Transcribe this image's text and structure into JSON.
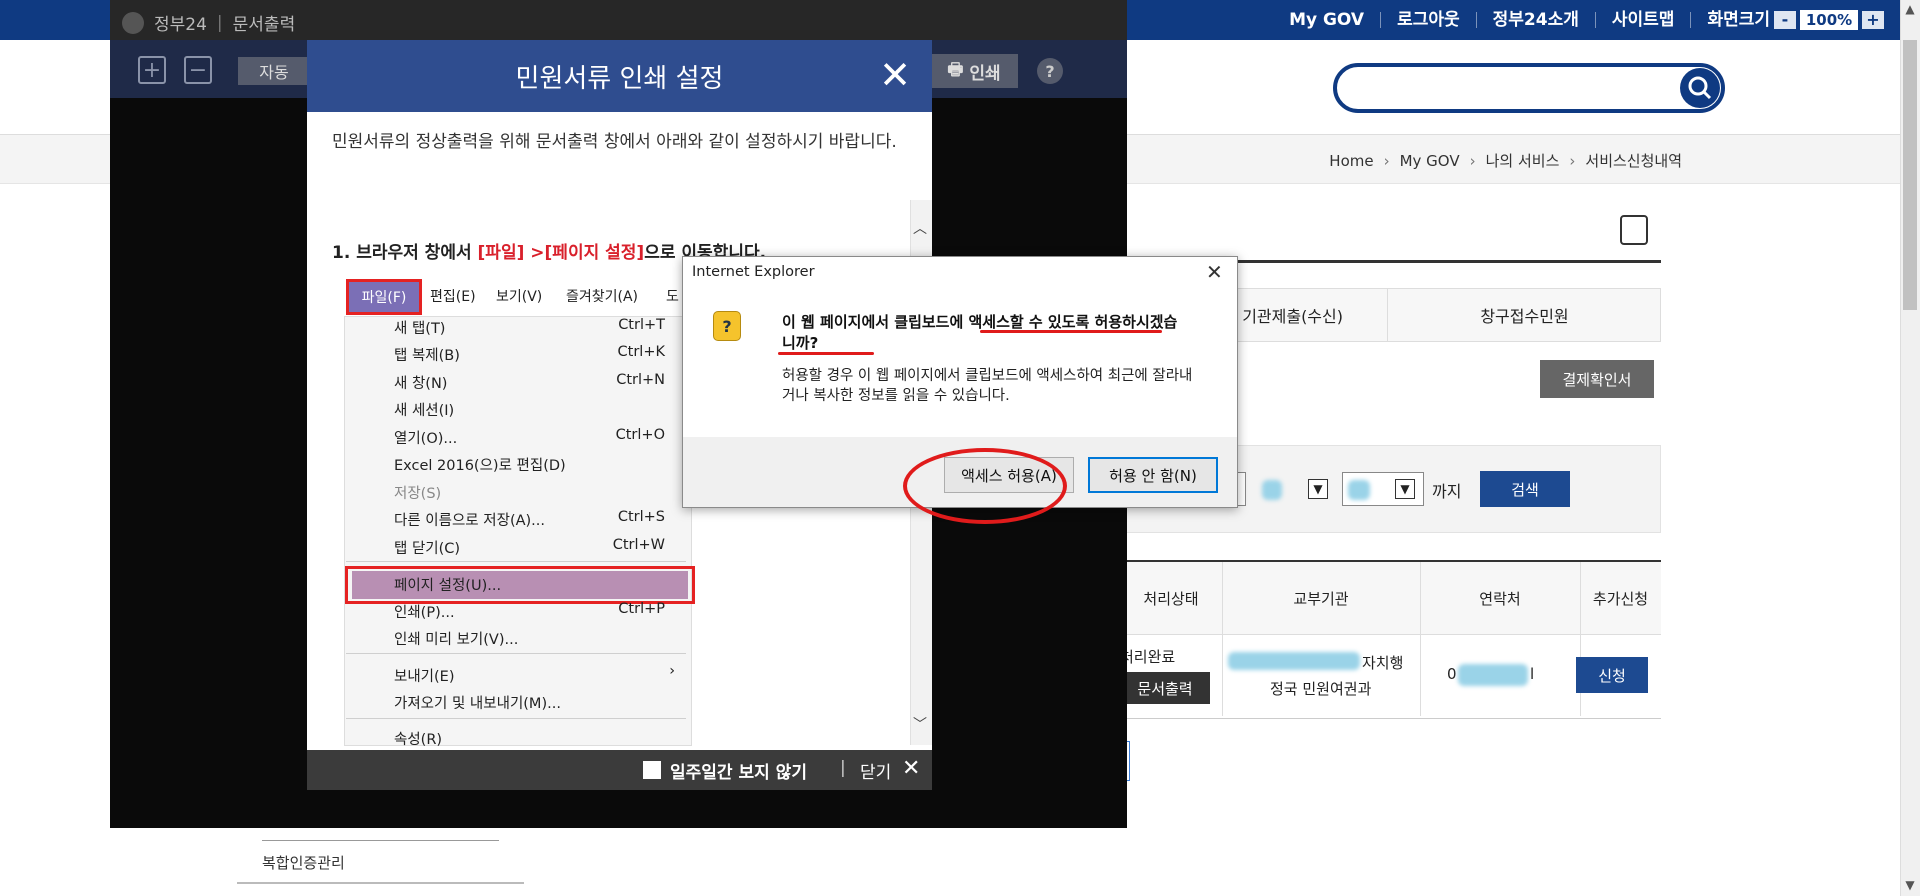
{
  "site": {
    "toplinks": [
      "My GOV",
      "로그아웃",
      "정부24소개",
      "사이트맵",
      "화면크기"
    ],
    "zoom": {
      "minus": "-",
      "value": "100%",
      "plus": "+"
    }
  },
  "breadcrumb": [
    "Home",
    "My GOV",
    "나의 서비스",
    "서비스신청내역"
  ],
  "tabs": [
    "기관제출(수신)",
    "창구접수민원"
  ],
  "pay_button": "결제확인서",
  "filter": {
    "until_label": "까지",
    "search_button": "검색"
  },
  "table": {
    "headers": [
      "처리상태",
      "교부기관",
      "연락처",
      "추가신청"
    ],
    "row": {
      "status": "처리완료",
      "doc_button": "문서출력",
      "agency_line1": "자치행",
      "agency_line2": "정국 민원여권과",
      "phone_prefix": "0",
      "phone_suffix": "l",
      "apply_button": "신청"
    }
  },
  "left_menu": {
    "item": "복합인증관리"
  },
  "doc_window": {
    "app_name": "정부24",
    "title": "문서출력",
    "auto_button": "자동",
    "print_button": "인쇄",
    "help_button": "?",
    "zoom_in": "+",
    "zoom_out": "−"
  },
  "print_modal": {
    "title": "민원서류 인쇄 설정",
    "intro": "민원서류의 정상출력을 위해 문서출력 창에서 아래와 같이 설정하시기 바랍니다.",
    "step_prefix": "1. 브라우저 창에서 ",
    "step_file": "[파일]",
    "step_arrow": " >",
    "step_page": "[페이지 설정]",
    "step_suffix": "으로 이동합니다.",
    "menubar": [
      "파일(F)",
      "편집(E)",
      "보기(V)",
      "즐겨찾기(A)",
      "도"
    ],
    "menu_items": [
      {
        "label": "새 탭(T)",
        "shortcut": "Ctrl+T"
      },
      {
        "label": "탭 복제(B)",
        "shortcut": "Ctrl+K"
      },
      {
        "label": "새 창(N)",
        "shortcut": "Ctrl+N"
      },
      {
        "label": "새 세션(I)",
        "shortcut": ""
      },
      {
        "label": "열기(O)...",
        "shortcut": "Ctrl+O"
      },
      {
        "label": "Excel 2016(으)로 편집(D)",
        "shortcut": ""
      },
      {
        "label": "저장(S)",
        "shortcut": ""
      },
      {
        "label": "다른 이름으로 저장(A)...",
        "shortcut": "Ctrl+S"
      },
      {
        "label": "탭 닫기(C)",
        "shortcut": "Ctrl+W"
      },
      {
        "label": "페이지 설정(U)...",
        "shortcut": ""
      },
      {
        "label": "인쇄(P)...",
        "shortcut": "Ctrl+P"
      },
      {
        "label": "인쇄 미리 보기(V)...",
        "shortcut": ""
      },
      {
        "label": "보내기(E)",
        "shortcut": "›"
      },
      {
        "label": "가져오기 및 내보내기(M)...",
        "shortcut": ""
      },
      {
        "label": "속성(R)",
        "shortcut": ""
      }
    ],
    "footer_dont_show": "일주일간 보지 않기",
    "footer_sep": "|",
    "footer_close": "닫기"
  },
  "ie_dialog": {
    "title": "Internet Explorer",
    "question": "이 웹 페이지에서 클립보드에 액세스할 수 있도록 허용하시겠습니까?",
    "description": "허용할 경우 이 웹 페이지에서 클립보드에 액세스하여 최근에 잘라내거나 복사한 정보를 읽을 수 있습니다.",
    "allow_button": "액세스 허용(A)",
    "deny_button": "허용 안 함(N)"
  },
  "colors": {
    "site_blue": "#0f3a82",
    "modal_blue": "#2f4d8f",
    "annotation_red": "#e01b1b"
  }
}
